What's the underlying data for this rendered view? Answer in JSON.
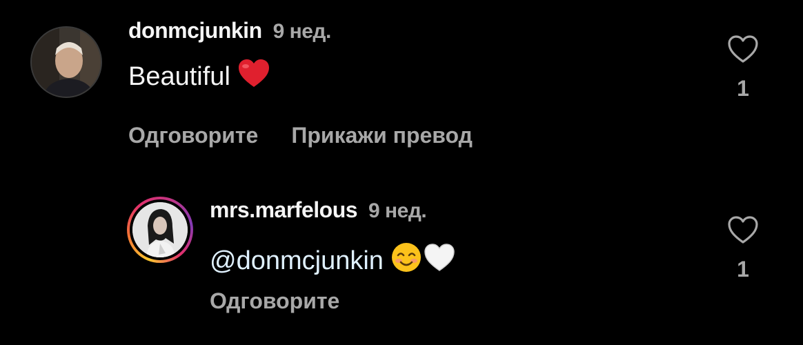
{
  "comments": [
    {
      "username": "donmcjunkin",
      "time": "9 нед.",
      "text": "Beautiful",
      "emoji": "red-heart",
      "actions": [
        "Одговорите",
        "Прикажи превод"
      ],
      "like_count": "1"
    },
    {
      "username": "mrs.marfelous",
      "time": "9 нед.",
      "text": "@donmcjunkin",
      "emoji": "smiling-face-and-white-heart",
      "actions": [
        "Одговорите"
      ],
      "like_count": "1"
    }
  ],
  "colors": {
    "background": "#000000",
    "text": "#f5f5f5",
    "secondary": "#a8a8a8"
  }
}
